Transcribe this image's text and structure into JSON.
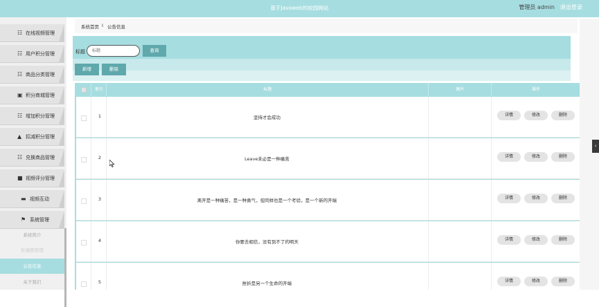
{
  "header": {
    "site_title": "基于Javaweb的校园网站",
    "user_label": "管理员 admin",
    "logout_label": "退出登录"
  },
  "sidebar": {
    "items": [
      {
        "label": "在线视频管理",
        "icon": "grid-icon"
      },
      {
        "label": "用户积分管理",
        "icon": "grid-icon"
      },
      {
        "label": "商品分类管理",
        "icon": "grid-icon"
      },
      {
        "label": "积分商城管理",
        "icon": "briefcase-icon"
      },
      {
        "label": "增加积分管理",
        "icon": "grid-icon"
      },
      {
        "label": "扣减积分管理",
        "icon": "user-icon"
      },
      {
        "label": "兑换商品管理",
        "icon": "grid-icon"
      },
      {
        "label": "视频评分管理",
        "icon": "printer-icon"
      },
      {
        "label": "视频互动",
        "icon": "ticket-icon"
      },
      {
        "label": "系统管理",
        "icon": "flag-icon"
      }
    ],
    "sub_items": [
      {
        "label": "系统简介"
      },
      {
        "label": "轮播图管理"
      },
      {
        "label": "公告信息"
      },
      {
        "label": "关于我们"
      }
    ]
  },
  "breadcrumb": {
    "home": "系统首页",
    "separator": "I",
    "current": "公告信息"
  },
  "search": {
    "label": "标题",
    "placeholder": "标题",
    "button": "查询"
  },
  "toolbar": {
    "add_label": "新增",
    "delete_label": "删除"
  },
  "table": {
    "columns": [
      "索引",
      "标题",
      "图片",
      "操作"
    ],
    "actions": [
      "详情",
      "修改",
      "删除"
    ],
    "rows": [
      {
        "index": "1",
        "title": "坚持才会成功"
      },
      {
        "index": "2",
        "title": "Leave未必是一种痛苦"
      },
      {
        "index": "3",
        "title": "离开是一种痛苦，是一种勇气，但同样也是一个考验，是一个新的开端"
      },
      {
        "index": "4",
        "title": "你要去相信，没有到不了的明天"
      },
      {
        "index": "5",
        "title": "挫折是另一个生命的开端"
      }
    ]
  },
  "colors": {
    "accent": "#a6dde0",
    "button": "#5fa8ab"
  }
}
